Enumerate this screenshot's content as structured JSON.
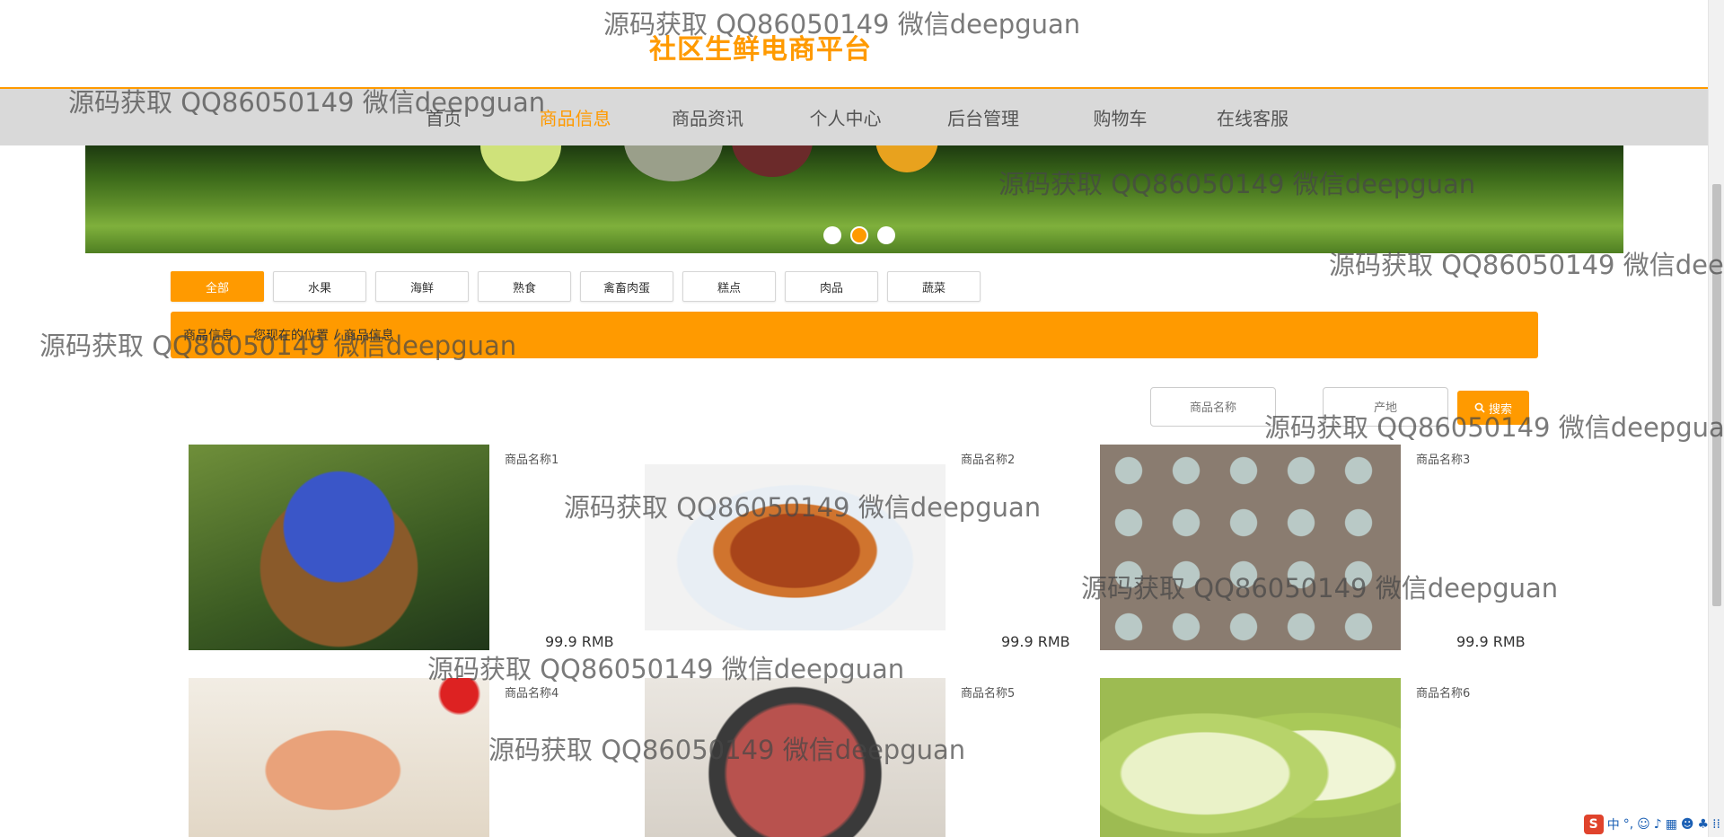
{
  "header": {
    "site_title": "社区生鲜电商平台"
  },
  "nav": {
    "items": [
      {
        "label": "首页"
      },
      {
        "label": "商品信息"
      },
      {
        "label": "商品资讯"
      },
      {
        "label": "个人中心"
      },
      {
        "label": "后台管理"
      },
      {
        "label": "购物车"
      },
      {
        "label": "在线客服"
      }
    ],
    "active_index": 1
  },
  "banner": {
    "slide_count": 3,
    "active_slide": 2
  },
  "categories": {
    "items": [
      {
        "label": "全部"
      },
      {
        "label": "水果"
      },
      {
        "label": "海鲜"
      },
      {
        "label": "熟食"
      },
      {
        "label": "禽畜肉蛋"
      },
      {
        "label": "糕点"
      },
      {
        "label": "肉品"
      },
      {
        "label": "蔬菜"
      }
    ],
    "active_index": 0
  },
  "breadcrumb": {
    "section": "商品信息",
    "location_label": "您现在的位置",
    "current": "商品信息",
    "separator": "/"
  },
  "search": {
    "name_placeholder": "商品名称",
    "origin_placeholder": "产地",
    "button_label": "搜索",
    "button_icon": "search-icon"
  },
  "products": [
    {
      "name": "商品名称1",
      "price": "99.9 RMB",
      "image": "blueberries"
    },
    {
      "name": "商品名称2",
      "price": "99.9 RMB",
      "image": "roast-duck"
    },
    {
      "name": "商品名称3",
      "price": "99.9 RMB",
      "image": "eggs"
    },
    {
      "name": "商品名称4",
      "price": "",
      "image": "cake"
    },
    {
      "name": "商品名称5",
      "price": "",
      "image": "ribs"
    },
    {
      "name": "商品名称6",
      "price": "",
      "image": "chinese-cabbage"
    }
  ],
  "watermark": {
    "text": "源码获取 QQ86050149 微信deepguan"
  },
  "ime": {
    "logo": "S",
    "mode": "中",
    "punct": "°,"
  },
  "colors": {
    "accent": "#ff9a00",
    "nav_bg": "#d9d9d9"
  }
}
